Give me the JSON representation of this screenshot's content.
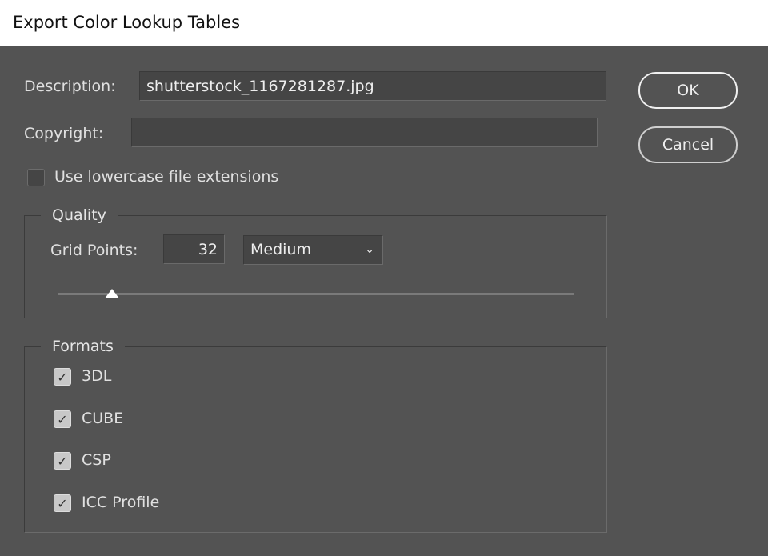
{
  "window": {
    "title": "Export Color Lookup Tables"
  },
  "description": {
    "label": "Description:",
    "value": "shutterstock_1167281287.jpg"
  },
  "copyright": {
    "label": "Copyright:",
    "value": ""
  },
  "lowercase": {
    "label": "Use lowercase file extensions",
    "checked": false
  },
  "quality": {
    "legend": "Quality",
    "grid_points_label": "Grid Points:",
    "grid_points_value": "32",
    "preset": "Medium",
    "slider_fraction": 0.105
  },
  "formats": {
    "legend": "Formats",
    "items": [
      {
        "label": "3DL",
        "checked": true
      },
      {
        "label": "CUBE",
        "checked": true
      },
      {
        "label": "CSP",
        "checked": true
      },
      {
        "label": "ICC Profile",
        "checked": true
      }
    ]
  },
  "buttons": {
    "ok": "OK",
    "cancel": "Cancel"
  }
}
